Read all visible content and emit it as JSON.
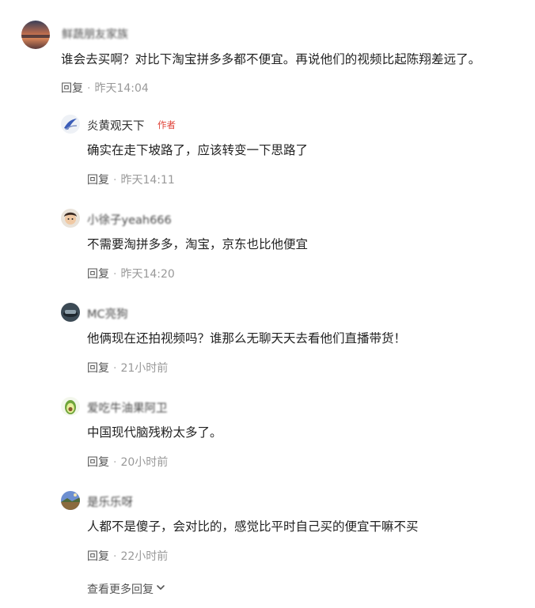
{
  "main_comment": {
    "username": "鲜蔬朋友家族",
    "text": "谁会去买啊？对比下淘宝拼多多都不便宜。再说他们的视频比起陈翔差远了。",
    "reply_label": "回复",
    "time": "昨天14:04"
  },
  "replies": [
    {
      "username": "炎黄观天下",
      "badge": "作者",
      "text": "确实在走下坡路了，应该转变一下思路了",
      "reply_label": "回复",
      "time": "昨天14:11"
    },
    {
      "username": "小徐子yeah666",
      "text": "不需要淘拼多多，淘宝，京东也比他便宜",
      "reply_label": "回复",
      "time": "昨天14:20"
    },
    {
      "username": "MC亮狗",
      "text": "他俩现在还拍视频吗？谁那么无聊天天去看他们直播带货！",
      "reply_label": "回复",
      "time": "21小时前"
    },
    {
      "username": "爱吃牛油果阿卫",
      "text": "中国现代脑残粉太多了。",
      "reply_label": "回复",
      "time": "20小时前"
    },
    {
      "username": "是乐乐呀",
      "text": "人都不是傻子，会对比的，感觉比平时自己买的便宜干嘛不买",
      "reply_label": "回复",
      "time": "22小时前"
    }
  ],
  "more_replies_label": "查看更多回复",
  "colors": {
    "meta_gray": "#999999",
    "reply_link": "#555555",
    "author_badge": "#e0443a",
    "text": "#222222"
  },
  "icons": {
    "more_replies": "chevron-down-icon"
  }
}
